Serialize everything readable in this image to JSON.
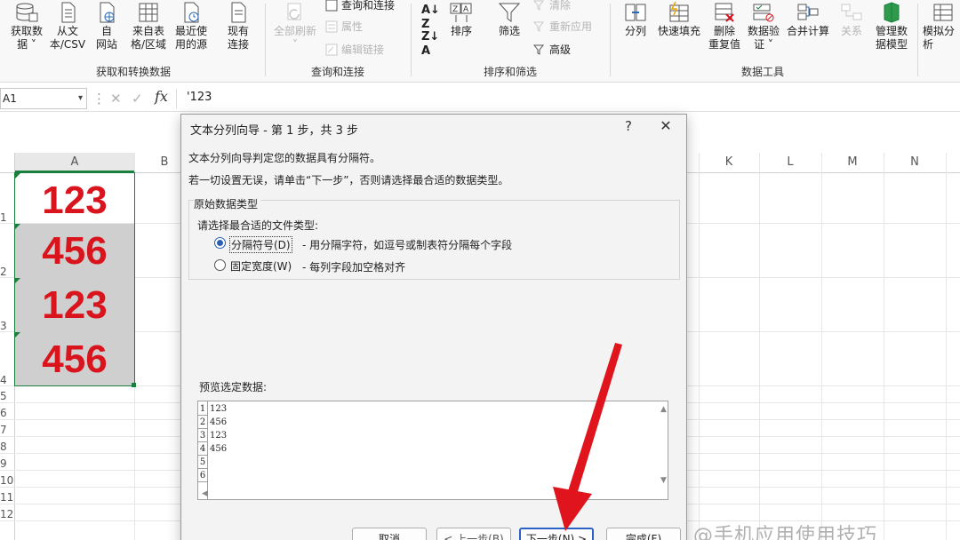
{
  "ribbon": {
    "get_data": {
      "label": "获取数\n据 ˅",
      "from_csv": "从文\n本/CSV",
      "from_web": "自\n网站",
      "from_table": "来自表\n格/区域",
      "recent_sources": "最近使\n用的源",
      "existing_conn": "现有\n连接",
      "group": "获取和转换数据"
    },
    "queries": {
      "refresh_all": "全部刷新",
      "refresh_all_arrow": "˅",
      "queries_connections": "查询和连接",
      "properties": "属性",
      "edit_links": "编辑链接",
      "group": "查询和连接"
    },
    "sort_filter": {
      "sort": "排序",
      "filter": "筛选",
      "clear": "清除",
      "reapply": "重新应用",
      "advanced": "高级",
      "group": "排序和筛选"
    },
    "data_tools": {
      "text_to_columns": "分列",
      "flash_fill": "快速填充",
      "remove_duplicates": "删除\n重复值",
      "data_validation": "数据验\n证 ˅",
      "consolidate": "合并计算",
      "relationships": "关系",
      "manage_model": "管理数\n据模型",
      "group": "数据工具"
    },
    "forecast": {
      "what_if": "模拟分\n析"
    }
  },
  "formula_bar": {
    "name_box": "A1",
    "formula": "'123",
    "cancel": "✕",
    "enter": "✓",
    "fx": "fx"
  },
  "sheet": {
    "columns_left": [
      "A",
      "B"
    ],
    "columns_right": [
      "K",
      "L",
      "M",
      "N"
    ],
    "rows": [
      "1",
      "2",
      "3",
      "4",
      "5",
      "6",
      "7",
      "8",
      "9",
      "10",
      "11",
      "12"
    ],
    "cells": [
      "123",
      "456",
      "123",
      "456"
    ]
  },
  "dialog": {
    "title": "文本分列向导 - 第 1 步，共 3 步",
    "help": "?",
    "close": "✕",
    "intro": "文本分列向导判定您的数据具有分隔符。",
    "hint": "若一切设置无误，请单击“下一步”，否则请选择最合适的数据类型。",
    "fieldset_title": "原始数据类型",
    "choose_label": "请选择最合适的文件类型:",
    "options": [
      {
        "label": "分隔符号(D)",
        "desc": "- 用分隔字符，如逗号或制表符分隔每个字段",
        "selected": true
      },
      {
        "label": "固定宽度(W)",
        "desc": "- 每列字段加空格对齐",
        "selected": false
      }
    ],
    "preview_label": "预览选定数据:",
    "preview_line_numbers": [
      "1",
      "2",
      "3",
      "4",
      "5",
      "6"
    ],
    "preview_rows": [
      "123",
      "456",
      "123",
      "456"
    ],
    "buttons": {
      "cancel": "取消",
      "back": "< 上一步(B)",
      "next": "下一步(N) >",
      "finish": "完成(F)"
    }
  },
  "watermark": "@手机应用使用技巧",
  "colors": {
    "cell_value": "#d9141c",
    "selection_fill": "#cfcfcf",
    "annotation_arrow": "#e0141c",
    "radio_accent": "#2b5fb0",
    "primary_border": "#2b63c4"
  }
}
